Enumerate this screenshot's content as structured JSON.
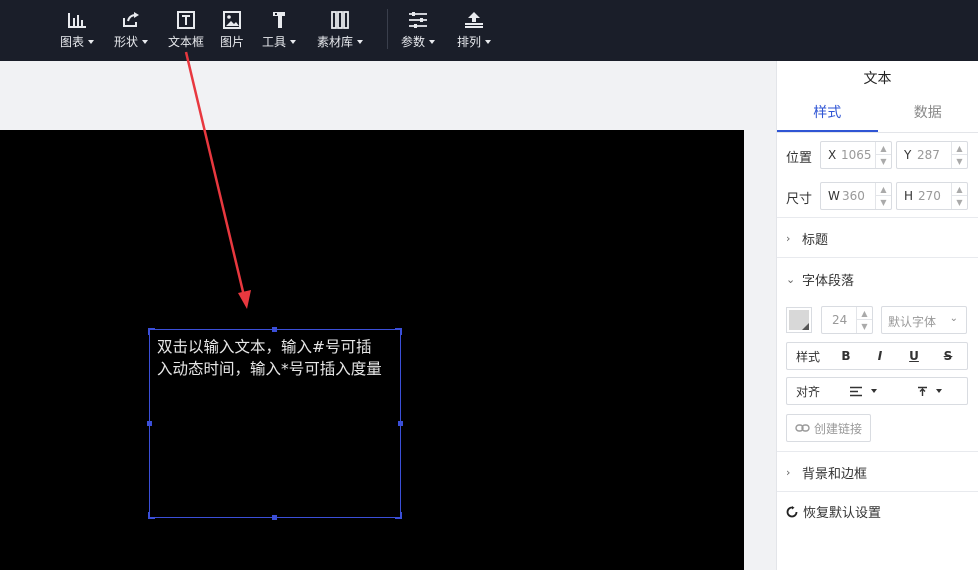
{
  "toolbar": {
    "items": [
      {
        "label": "图表",
        "icon": "bar-chart-icon",
        "dropdown": true
      },
      {
        "label": "形状",
        "icon": "shape-share-icon",
        "dropdown": true
      },
      {
        "label": "文本框",
        "icon": "text-box-icon",
        "dropdown": false
      },
      {
        "label": "图片",
        "icon": "image-icon",
        "dropdown": false
      },
      {
        "label": "工具",
        "icon": "hammer-icon",
        "dropdown": true
      },
      {
        "label": "素材库",
        "icon": "library-icon",
        "dropdown": true
      },
      {
        "label": "参数",
        "icon": "sliders-icon",
        "dropdown": true
      },
      {
        "label": "排列",
        "icon": "arrange-icon",
        "dropdown": true
      }
    ]
  },
  "canvas": {
    "textbox_lines": "双击以输入文本，输入#号可插\n入动态时间，输入*号可插入度量"
  },
  "panel": {
    "title": "文本",
    "tabs": [
      "样式",
      "数据"
    ],
    "active_tab": "样式",
    "position": {
      "label": "位置",
      "x_prefix": "X",
      "x": "1065",
      "y_prefix": "Y",
      "y": "287"
    },
    "size": {
      "label": "尺寸",
      "w_prefix": "W",
      "w": "360",
      "h_prefix": "H",
      "h": "270"
    },
    "sections": {
      "title": "标题",
      "font": "字体段落",
      "bg": "背景和边框"
    },
    "font_size": "24",
    "font_family": "默认字体",
    "style_label": "样式",
    "align_label": "对齐",
    "link_label": "创建链接",
    "reset_label": "恢复默认设置"
  },
  "colors": {
    "toolbar_bg": "#1a1e29",
    "accent": "#2f55d4",
    "selection": "#3b4fd8",
    "arrow": "#e8383f",
    "canvas_bg": "#000000"
  }
}
